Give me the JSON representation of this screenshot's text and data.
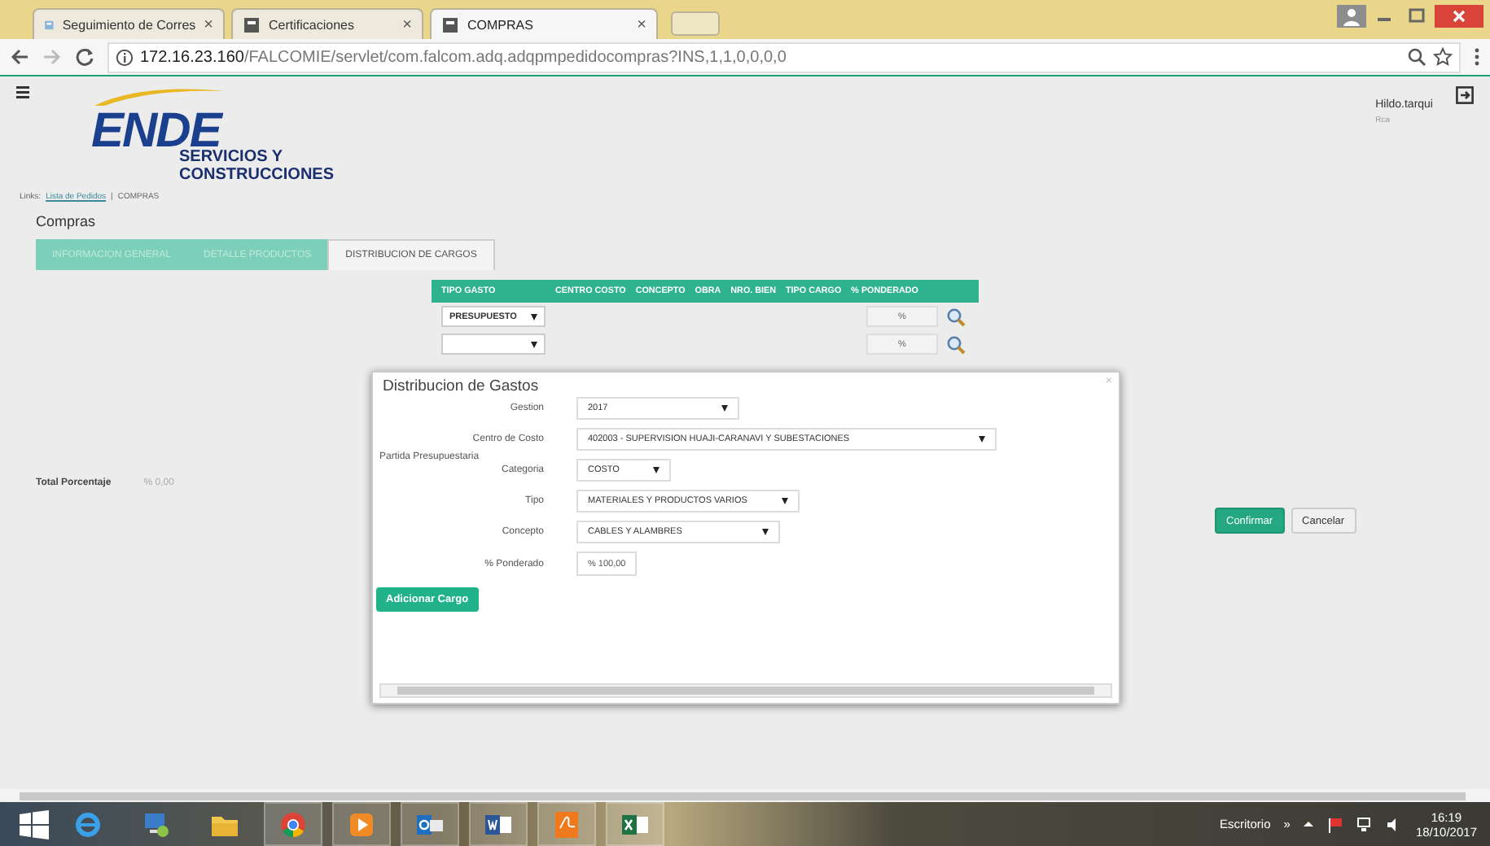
{
  "browser": {
    "tabs": [
      {
        "label": "Seguimiento de Corres",
        "close": "×",
        "selected": false
      },
      {
        "label": "Certificaciones",
        "close": "×",
        "selected": false
      },
      {
        "label": "COMPRAS",
        "close": "×",
        "selected": true
      }
    ],
    "url_host": "172.16.23.160",
    "url_path": "/FALCOMIE/servlet/com.falcom.adq.adqpmpedidocompras?INS,1,1,0,0,0,0"
  },
  "header": {
    "logo": "ENDE",
    "logo_sub": [
      "SERVICIOS Y",
      "CONSTRUCCIONES"
    ],
    "user": "Hildo.tarqui",
    "user_role": "Rca"
  },
  "breadcrumb": {
    "label": "Links:",
    "separator": "|",
    "items": [
      "Lista de Pedidos",
      "COMPRAS"
    ]
  },
  "page_title": "Compras",
  "tabs": [
    {
      "label": "INFORMACION GENERAL",
      "selected": false
    },
    {
      "label": "DETALLE PRODUCTOS",
      "selected": false
    },
    {
      "label": "DISTRIBUCION DE CARGOS",
      "selected": true
    }
  ],
  "table": {
    "columns": [
      "TIPO GASTO",
      "CENTRO COSTO",
      "CONCEPTO",
      "OBRA",
      "NRO. BIEN",
      "TIPO CARGO",
      "% PONDERADO"
    ],
    "rows": [
      {
        "tipo_gasto": "PRESUPUESTO",
        "ponderado": "%"
      },
      {
        "ponderado": "%"
      }
    ]
  },
  "total": {
    "label": "Total Porcentaje",
    "value": "% 0,00"
  },
  "buttons": [
    {
      "label": "Confirmar",
      "kind": "primary"
    },
    {
      "label": "Cancelar",
      "kind": "secondary"
    }
  ],
  "modal": {
    "title": "Distribucion de Gastos",
    "close": "×",
    "fields": [
      {
        "label": "Gestion",
        "kind": "select",
        "value": "2017"
      },
      {
        "label": "Centro de Costo",
        "kind": "select",
        "value": "402003 - SUPERVISION HUAJI-CARANAVI Y SUBESTACIONES"
      },
      {
        "label": "Partida Presupuestaria",
        "kind": "section"
      },
      {
        "label": "Categoria",
        "kind": "select",
        "value": "COSTO"
      },
      {
        "label": "Tipo",
        "kind": "select",
        "value": "MATERIALES Y PRODUCTOS VARIOS"
      },
      {
        "label": "Concepto",
        "kind": "select",
        "value": "CABLES Y ALAMBRES"
      },
      {
        "label": "% Ponderado",
        "kind": "input",
        "value": "% 100,00"
      }
    ],
    "button": "Adicionar Cargo"
  },
  "taskbar": {
    "apps": [
      {
        "kind": "ie",
        "active": false
      },
      {
        "kind": "network",
        "active": false
      },
      {
        "kind": "folder",
        "active": false
      },
      {
        "kind": "chrome",
        "active": true
      },
      {
        "kind": "media",
        "active": true
      },
      {
        "kind": "outlook",
        "active": true
      },
      {
        "kind": "word",
        "active": true
      },
      {
        "kind": "pdf",
        "active": true
      },
      {
        "kind": "excel",
        "active": true
      }
    ],
    "desktop": "Escritorio",
    "chevron": "»",
    "time": "16:19",
    "date": "18/10/2017"
  }
}
